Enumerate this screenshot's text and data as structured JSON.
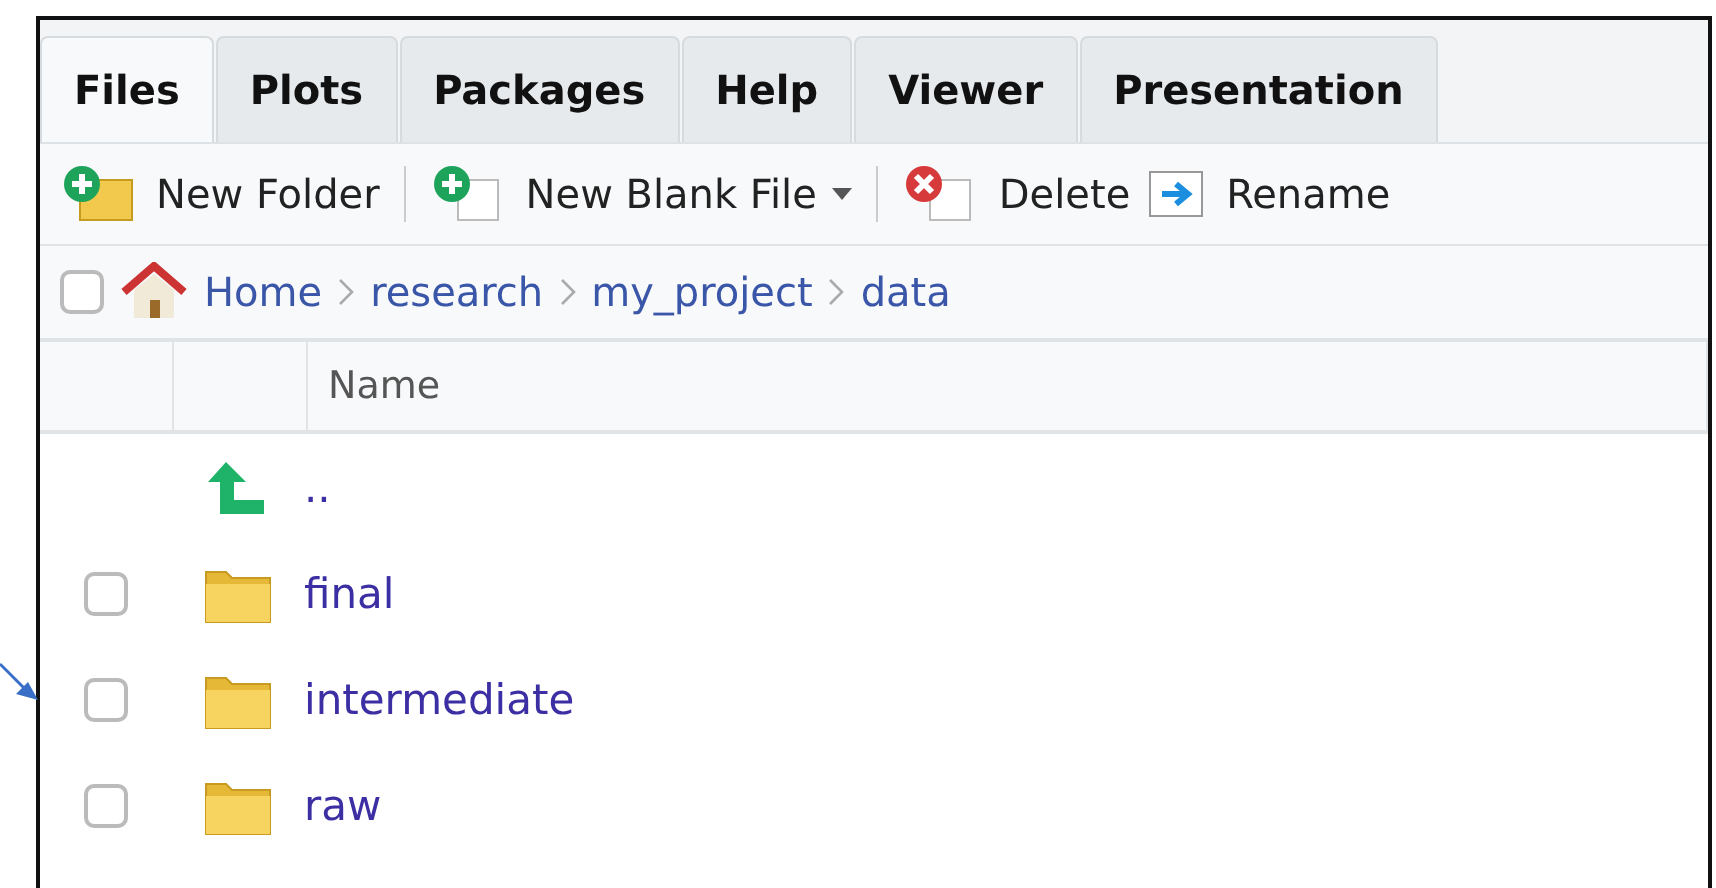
{
  "tabs": [
    {
      "label": "Files",
      "selected": true
    },
    {
      "label": "Plots",
      "selected": false
    },
    {
      "label": "Packages",
      "selected": false
    },
    {
      "label": "Help",
      "selected": false
    },
    {
      "label": "Viewer",
      "selected": false
    },
    {
      "label": "Presentation",
      "selected": false
    }
  ],
  "toolbar": [
    {
      "kind": "new-folder",
      "label": "New Folder"
    },
    {
      "kind": "new-file",
      "label": "New Blank File",
      "dropdown": true
    },
    {
      "kind": "delete",
      "label": "Delete"
    },
    {
      "kind": "rename",
      "label": "Rename"
    }
  ],
  "breadcrumb": {
    "checked": false,
    "path": [
      "Home",
      "research",
      "my_project",
      "data"
    ]
  },
  "table": {
    "columns": [
      "Name"
    ],
    "rows": [
      {
        "kind": "parent",
        "name": ".."
      },
      {
        "kind": "folder",
        "name": "final",
        "checked": false
      },
      {
        "kind": "folder",
        "name": "intermediate",
        "checked": false
      },
      {
        "kind": "folder",
        "name": "raw",
        "checked": false
      }
    ]
  }
}
